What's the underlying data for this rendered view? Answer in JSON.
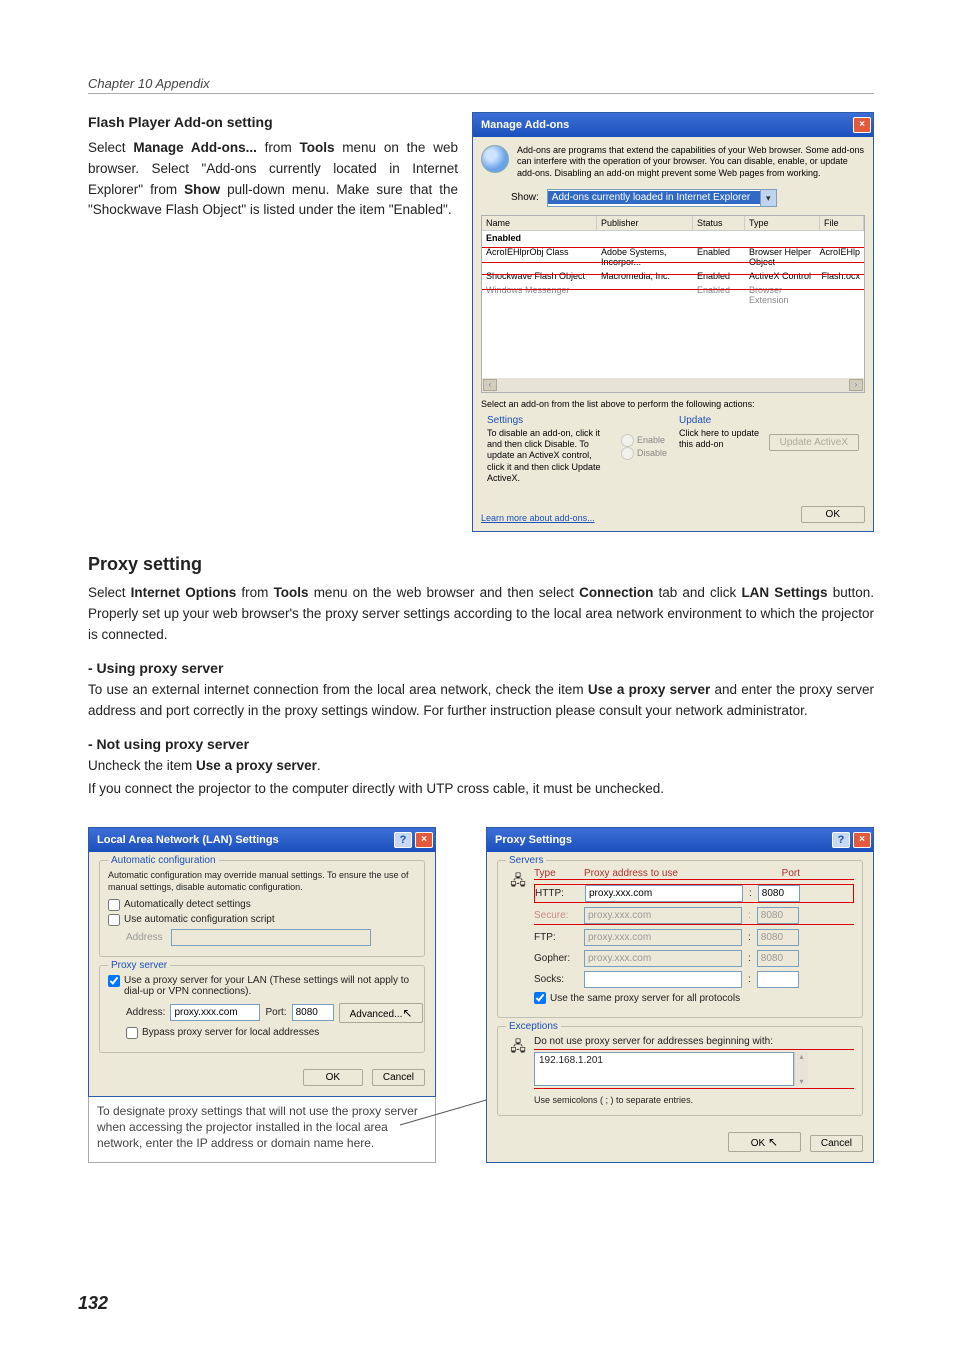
{
  "chapter": "Chapter 10 Appendix",
  "pageNum": "132",
  "section1": {
    "title": "Flash Player Add-on setting",
    "p1a": "Select ",
    "p1b": "Manage Add-ons...",
    "p1c": " from ",
    "p1d": "Tools",
    "p1e": " menu on the web browser. Select \"Add-ons currently located in Internet Explorer\" from ",
    "p1f": "Show",
    "p1g": " pull-down menu. Make sure that the \"Shockwave Flash Object\" is listed under the item \"Enabled\"."
  },
  "addonsDlg": {
    "title": "Manage Add-ons",
    "close": "×",
    "desc": "Add-ons are programs that extend the capabilities of your Web browser. Some add-ons can interfere with the operation of your browser. You can disable, enable, or update add-ons. Disabling an add-on might prevent some Web pages from working.",
    "showLabel": "Show:",
    "showValue": "Add-ons currently loaded in Internet Explorer",
    "ddArrow": "▾",
    "cols": {
      "name": "Name",
      "pub": "Publisher",
      "stat": "Status",
      "type": "Type",
      "file": "File"
    },
    "group": "Enabled",
    "rows": [
      {
        "name": "AcroIEHlprObj Class",
        "pub": "Adobe Systems, Incorpor...",
        "stat": "Enabled",
        "type": "Browser Helper Object",
        "file": "AcroIEHlp"
      },
      {
        "name": "Shockwave Flash Object",
        "pub": "Macromedia, Inc.",
        "stat": "Enabled",
        "type": "ActiveX Control",
        "file": "Flash.ocx"
      },
      {
        "name": "Windows Messenger",
        "pub": "",
        "stat": "Enabled",
        "type": "Browser Extension",
        "file": ""
      }
    ],
    "scrollL": "‹",
    "scrollR": "›",
    "selectNote": "Select an add-on from the list above to perform the following actions:",
    "settingsTitle": "Settings",
    "settingsText": "To disable an add-on, click it and then click Disable. To update an ActiveX control, click it and then click Update ActiveX.",
    "enable": "Enable",
    "disable": "Disable",
    "updateTitle": "Update",
    "updateText": "Click here to update this add-on",
    "updateBtn": "Update ActiveX",
    "learn": "Learn more about add-ons...",
    "ok": "OK"
  },
  "proxySection": {
    "title": "Proxy setting",
    "p1a": "Select ",
    "p1b": "Internet Options",
    "p1c": " from ",
    "p1d": "Tools",
    "p1e": " menu on the web browser and then select ",
    "p1f": "Connection",
    "p1g": " tab and click ",
    "p1h": "LAN Settings",
    "p1i": " button. Properly set up your web browser's the proxy server settings according to the local area network environment to which the projector is connected.",
    "sub1": "- Using proxy server",
    "p2a": "To use an external internet connection from the local area network, check the item ",
    "p2b": "Use a proxy server",
    "p2c": " and enter the proxy server address and port correctly in the proxy settings window. For further instruction please consult your network administrator.",
    "sub2": "- Not using proxy server",
    "p3a": "Uncheck the item ",
    "p3b": "Use a proxy server",
    "p3c": ".",
    "p3d": "If you connect the projector to the computer directly with UTP cross cable, it must be unchecked."
  },
  "lanDlg": {
    "title": "Local Area Network (LAN) Settings",
    "help": "?",
    "close": "×",
    "autoTitle": "Automatic configuration",
    "autoText": "Automatic configuration may override manual settings.  To ensure the use of manual settings, disable automatic configuration.",
    "chk1": "Automatically detect settings",
    "chk2": "Use automatic configuration script",
    "addrLbl": "Address",
    "proxyTitle": "Proxy server",
    "chk3a": "Use a proxy server for your LAN (These settings will not apply to",
    "chk3b": "dial-up or VPN connections).",
    "addressLbl": "Address:",
    "addressVal": "proxy.xxx.com",
    "portLbl": "Port:",
    "portVal": "8080",
    "advBtn": "Advanced...",
    "chk4": "Bypass proxy server for local addresses",
    "ok": "OK",
    "cancel": "Cancel",
    "note": "To designate proxy settings that will not use the proxy server when accessing the projector installed in the local area network, enter the IP address or domain name here."
  },
  "proxyDlg": {
    "title": "Proxy Settings",
    "help": "?",
    "close": "×",
    "serversTitle": "Servers",
    "typeHdr": "Type",
    "addrHdr": "Proxy address to use",
    "portHdr": "Port",
    "rows": {
      "http": {
        "lbl": "HTTP:",
        "addr": "proxy.xxx.com",
        "port": "8080"
      },
      "secure": {
        "lbl": "Secure:",
        "addr": "proxy.xxx.com",
        "port": "8080"
      },
      "ftp": {
        "lbl": "FTP:",
        "addr": "proxy.xxx.com",
        "port": "8080"
      },
      "gopher": {
        "lbl": "Gopher:",
        "addr": "proxy.xxx.com",
        "port": "8080"
      },
      "socks": {
        "lbl": "Socks:",
        "addr": "",
        "port": ""
      }
    },
    "same": "Use the same proxy server for all protocols",
    "excTitle": "Exceptions",
    "excText": "Do not use proxy server for addresses beginning with:",
    "excVal": "192.168.1.201",
    "semi": "Use semicolons ( ; ) to separate entries.",
    "ok": "OK",
    "cancel": "Cancel"
  }
}
